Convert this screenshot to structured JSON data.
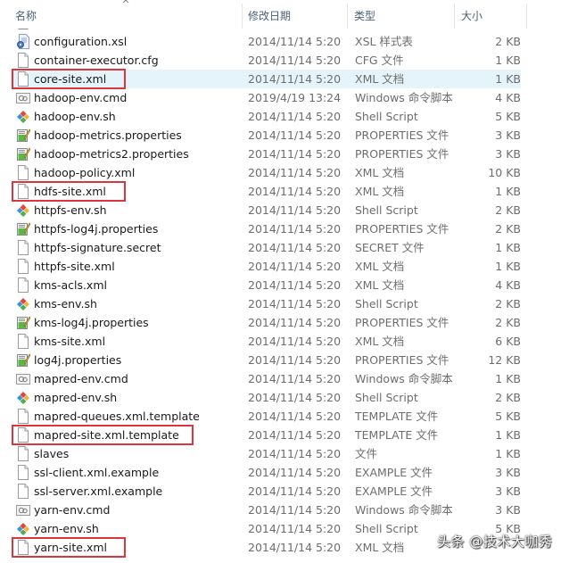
{
  "header": {
    "columns": [
      {
        "label": "名称"
      },
      {
        "label": "修改日期"
      },
      {
        "label": "类型"
      },
      {
        "label": "大小"
      }
    ],
    "sort_indicator": "^"
  },
  "files": [
    {
      "name": "configuration.xsl",
      "date": "2014/11/14 5:20",
      "type": "XSL 样式表",
      "size": "2 KB",
      "icon": "xsl-stylesheet-icon",
      "highlighted": false,
      "selected": false
    },
    {
      "name": "container-executor.cfg",
      "date": "2014/11/14 5:20",
      "type": "CFG 文件",
      "size": "1 KB",
      "icon": "blank-file-icon",
      "highlighted": false,
      "selected": false
    },
    {
      "name": "core-site.xml",
      "date": "2014/11/14 5:20",
      "type": "XML 文档",
      "size": "1 KB",
      "icon": "blank-file-icon",
      "highlighted": true,
      "selected": true
    },
    {
      "name": "hadoop-env.cmd",
      "date": "2019/4/19 13:24",
      "type": "Windows 命令脚本",
      "size": "4 KB",
      "icon": "cmd-script-icon",
      "highlighted": false,
      "selected": false
    },
    {
      "name": "hadoop-env.sh",
      "date": "2014/11/14 5:20",
      "type": "Shell Script",
      "size": "5 KB",
      "icon": "shell-script-icon",
      "highlighted": false,
      "selected": false
    },
    {
      "name": "hadoop-metrics.properties",
      "date": "2014/11/14 5:20",
      "type": "PROPERTIES 文件",
      "size": "3 KB",
      "icon": "properties-file-icon",
      "highlighted": false,
      "selected": false
    },
    {
      "name": "hadoop-metrics2.properties",
      "date": "2014/11/14 5:20",
      "type": "PROPERTIES 文件",
      "size": "3 KB",
      "icon": "properties-file-icon",
      "highlighted": false,
      "selected": false
    },
    {
      "name": "hadoop-policy.xml",
      "date": "2014/11/14 5:20",
      "type": "XML 文档",
      "size": "10 KB",
      "icon": "blank-file-icon",
      "highlighted": false,
      "selected": false
    },
    {
      "name": "hdfs-site.xml",
      "date": "2014/11/14 5:20",
      "type": "XML 文档",
      "size": "1 KB",
      "icon": "blank-file-icon",
      "highlighted": true,
      "selected": false
    },
    {
      "name": "httpfs-env.sh",
      "date": "2014/11/14 5:20",
      "type": "Shell Script",
      "size": "2 KB",
      "icon": "shell-script-icon",
      "highlighted": false,
      "selected": false
    },
    {
      "name": "httpfs-log4j.properties",
      "date": "2014/11/14 5:20",
      "type": "PROPERTIES 文件",
      "size": "2 KB",
      "icon": "properties-file-icon",
      "highlighted": false,
      "selected": false
    },
    {
      "name": "httpfs-signature.secret",
      "date": "2014/11/14 5:20",
      "type": "SECRET 文件",
      "size": "1 KB",
      "icon": "blank-file-icon",
      "highlighted": false,
      "selected": false
    },
    {
      "name": "httpfs-site.xml",
      "date": "2014/11/14 5:20",
      "type": "XML 文档",
      "size": "1 KB",
      "icon": "blank-file-icon",
      "highlighted": false,
      "selected": false
    },
    {
      "name": "kms-acls.xml",
      "date": "2014/11/14 5:20",
      "type": "XML 文档",
      "size": "4 KB",
      "icon": "blank-file-icon",
      "highlighted": false,
      "selected": false
    },
    {
      "name": "kms-env.sh",
      "date": "2014/11/14 5:20",
      "type": "Shell Script",
      "size": "2 KB",
      "icon": "shell-script-icon",
      "highlighted": false,
      "selected": false
    },
    {
      "name": "kms-log4j.properties",
      "date": "2014/11/14 5:20",
      "type": "PROPERTIES 文件",
      "size": "2 KB",
      "icon": "properties-file-icon",
      "highlighted": false,
      "selected": false
    },
    {
      "name": "kms-site.xml",
      "date": "2014/11/14 5:20",
      "type": "XML 文档",
      "size": "6 KB",
      "icon": "blank-file-icon",
      "highlighted": false,
      "selected": false
    },
    {
      "name": "log4j.properties",
      "date": "2014/11/14 5:20",
      "type": "PROPERTIES 文件",
      "size": "12 KB",
      "icon": "properties-file-icon",
      "highlighted": false,
      "selected": false
    },
    {
      "name": "mapred-env.cmd",
      "date": "2014/11/14 5:20",
      "type": "Windows 命令脚本",
      "size": "1 KB",
      "icon": "cmd-script-icon",
      "highlighted": false,
      "selected": false
    },
    {
      "name": "mapred-env.sh",
      "date": "2014/11/14 5:20",
      "type": "Shell Script",
      "size": "2 KB",
      "icon": "shell-script-icon",
      "highlighted": false,
      "selected": false
    },
    {
      "name": "mapred-queues.xml.template",
      "date": "2014/11/14 5:20",
      "type": "TEMPLATE 文件",
      "size": "5 KB",
      "icon": "blank-file-icon",
      "highlighted": false,
      "selected": false
    },
    {
      "name": "mapred-site.xml.template",
      "date": "2014/11/14 5:20",
      "type": "TEMPLATE 文件",
      "size": "1 KB",
      "icon": "blank-file-icon",
      "highlighted": true,
      "selected": false
    },
    {
      "name": "slaves",
      "date": "2014/11/14 5:20",
      "type": "文件",
      "size": "1 KB",
      "icon": "blank-file-icon",
      "highlighted": false,
      "selected": false
    },
    {
      "name": "ssl-client.xml.example",
      "date": "2014/11/14 5:20",
      "type": "EXAMPLE 文件",
      "size": "3 KB",
      "icon": "blank-file-icon",
      "highlighted": false,
      "selected": false
    },
    {
      "name": "ssl-server.xml.example",
      "date": "2014/11/14 5:20",
      "type": "EXAMPLE 文件",
      "size": "3 KB",
      "icon": "blank-file-icon",
      "highlighted": false,
      "selected": false
    },
    {
      "name": "yarn-env.cmd",
      "date": "2014/11/14 5:20",
      "type": "Windows 命令脚本",
      "size": "3 KB",
      "icon": "cmd-script-icon",
      "highlighted": false,
      "selected": false
    },
    {
      "name": "yarn-env.sh",
      "date": "2014/11/14 5:20",
      "type": "Shell Script",
      "size": "5 KB",
      "icon": "shell-script-icon",
      "highlighted": false,
      "selected": false
    },
    {
      "name": "yarn-site.xml",
      "date": "2014/11/14 5:20",
      "type": "XML 文档",
      "size": "",
      "icon": "blank-file-icon",
      "highlighted": true,
      "selected": false
    }
  ],
  "watermark": "头条 @技术大咖秀",
  "colors": {
    "highlight_border": "#d9363e",
    "selected_row": "#e5f3fb",
    "header_text": "#4c607a",
    "secondary_text": "#6d6d6d"
  }
}
